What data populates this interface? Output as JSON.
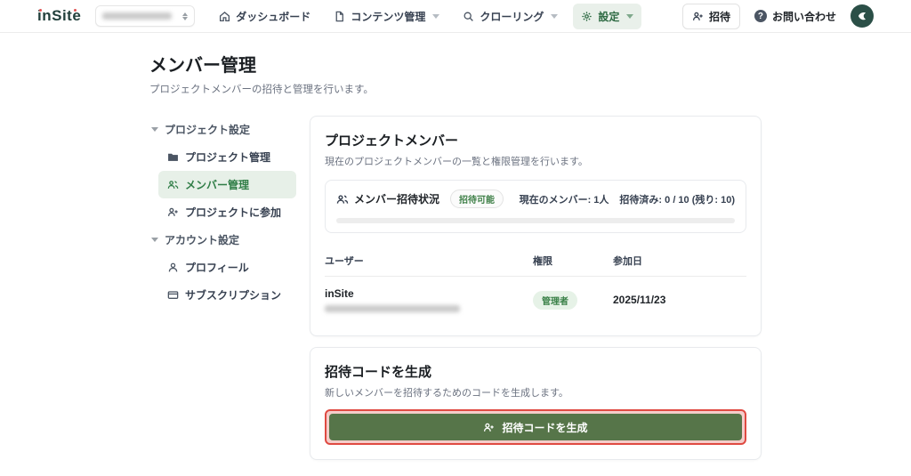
{
  "brand": {
    "name": "inSite"
  },
  "nav": {
    "items": [
      {
        "label": "ダッシュボード",
        "icon": "home-icon",
        "chevron": false,
        "active": false
      },
      {
        "label": "コンテンツ管理",
        "icon": "document-icon",
        "chevron": true,
        "active": false
      },
      {
        "label": "クローリング",
        "icon": "search-icon",
        "chevron": true,
        "active": false
      },
      {
        "label": "設定",
        "icon": "gear-icon",
        "chevron": true,
        "active": true
      }
    ],
    "invite_button": "招待",
    "contact_label": "お問い合わせ"
  },
  "page": {
    "title": "メンバー管理",
    "subtitle": "プロジェクトメンバーの招待と管理を行います。"
  },
  "sidebar": {
    "sections": [
      {
        "label": "プロジェクト設定",
        "items": [
          {
            "label": "プロジェクト管理",
            "icon": "folder-icon",
            "active": false
          },
          {
            "label": "メンバー管理",
            "icon": "users-icon",
            "active": true
          },
          {
            "label": "プロジェクトに参加",
            "icon": "user-plus-icon",
            "active": false
          }
        ]
      },
      {
        "label": "アカウント設定",
        "items": [
          {
            "label": "プロフィール",
            "icon": "user-icon",
            "active": false
          },
          {
            "label": "サブスクリプション",
            "icon": "credit-card-icon",
            "active": false
          }
        ]
      }
    ]
  },
  "members_card": {
    "title": "プロジェクトメンバー",
    "subtitle": "現在のプロジェクトメンバーの一覧と権限管理を行います。",
    "status": {
      "label": "メンバー招待状況",
      "badge": "招待可能",
      "current_members": "現在のメンバー: 1人",
      "invited": "招待済み: 0 / 10 (残り: 10)",
      "progress_percent": 0
    },
    "table": {
      "headers": [
        "ユーザー",
        "権限",
        "参加日"
      ],
      "rows": [
        {
          "user": "inSite",
          "role": "管理者",
          "joined": "2025/11/23"
        }
      ]
    }
  },
  "invite_card": {
    "title": "招待コードを生成",
    "subtitle": "新しいメンバーを招待するためのコードを生成します。",
    "button": "招待コードを生成"
  },
  "colors": {
    "accent_green": "#2f7d46",
    "button_green": "#567549",
    "annotation_red": "#df4a42",
    "badge_green_bg": "#e6f2e7",
    "logo_teal": "#22403c",
    "logo_dot_red": "#e05252"
  }
}
